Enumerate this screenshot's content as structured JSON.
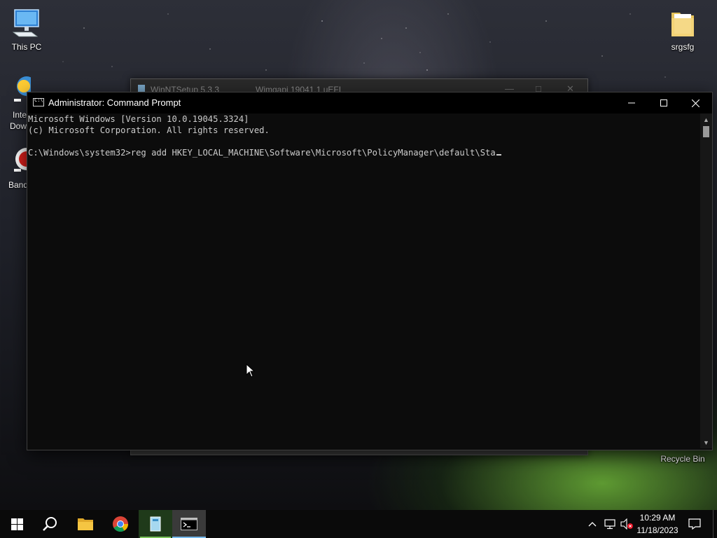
{
  "desktop": {
    "icons": [
      {
        "label": "This PC",
        "icon": "this-pc-icon"
      },
      {
        "label": "srgsfg",
        "icon": "folder-icon"
      },
      {
        "label": "Recycle Bin",
        "icon": "recycle-bin-icon"
      }
    ],
    "partial_icons": [
      {
        "label_line1": "Inte",
        "label_line2": "Dow",
        "icon": "internet-download-manager-icon"
      },
      {
        "label_line1": "Band",
        "icon": "bandicam-icon"
      }
    ]
  },
  "background_window": {
    "title": "WinNTSetup 5.3.3",
    "subtitle": "Wimgapi 19041.1   uEFI"
  },
  "cmd_window": {
    "title": "Administrator: Command Prompt",
    "lines": [
      "Microsoft Windows [Version 10.0.19045.3324]",
      "(c) Microsoft Corporation. All rights reserved.",
      "",
      "C:\\Windows\\system32>reg add HKEY_LOCAL_MACHINE\\Software\\Microsoft\\PolicyManager\\default\\Sta"
    ],
    "controls": {
      "minimize": "minimize-icon",
      "maximize": "maximize-icon",
      "close": "close-icon"
    }
  },
  "taskbar": {
    "apps": [
      {
        "name": "start",
        "icon": "windows-logo-icon"
      },
      {
        "name": "search",
        "icon": "search-icon"
      },
      {
        "name": "file-explorer",
        "icon": "folder-icon"
      },
      {
        "name": "chrome",
        "icon": "chrome-icon"
      },
      {
        "name": "winntsetup",
        "icon": "winntsetup-icon"
      },
      {
        "name": "command-prompt",
        "icon": "cmd-icon"
      }
    ],
    "tray": {
      "clock_time": "10:29 AM",
      "clock_date": "11/18/2023"
    }
  },
  "colors": {
    "console_bg": "#0c0c0c",
    "console_text": "#cccccc",
    "taskbar_accent": "#76b9ed"
  }
}
